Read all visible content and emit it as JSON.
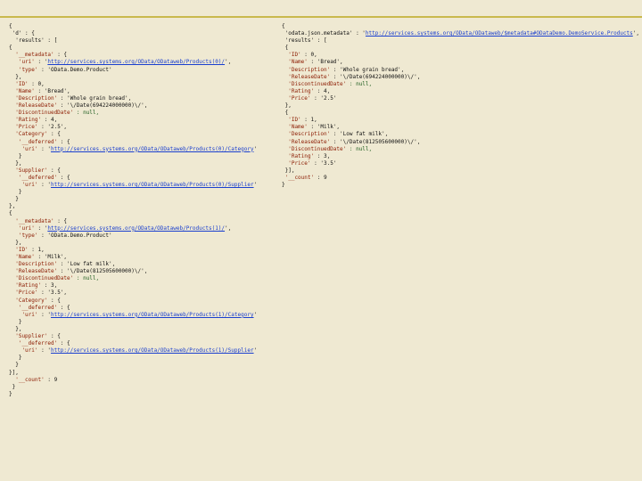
{
  "left": {
    "l01": "{",
    "l02": " 'd' : {",
    "l03": "  'results' : [",
    "l04": "{",
    "l05_k": "  '__metadata'",
    "l05_s": " : {",
    "l06_k": "   'uri'",
    "l06_s": " : '",
    "l06_u": "http://services.systems.org/OData/ODataweb/Products(0)/",
    "l06_e": "',",
    "l07_k": "   'type'",
    "l07_v": " : 'OData.Demo.Product'",
    "l08": "  },",
    "l09_k": "  'ID'",
    "l09_v": " : 0,",
    "l10_k": "  'Name'",
    "l10_v": " : 'Bread',",
    "l11_k": "  'Description'",
    "l11_v": " : 'Whole grain bread',",
    "l12_k": "  'ReleaseDate'",
    "l12_v": " : '\\/Date(694224000000)\\/',",
    "l13_k": "  'DiscontinuedDate'",
    "l13_v": " : null,",
    "l14_k": "  'Rating'",
    "l14_v": " : 4,",
    "l15_k": "  'Price'",
    "l15_v": " : '2.5',",
    "l16_k": "  'Category'",
    "l16_s": " : {",
    "l17_k": "   '__deferred'",
    "l17_s": " : {",
    "l18_k": "    'uri'",
    "l18_s": " : '",
    "l18_u": "http://services.systems.org/OData/ODataweb/Products(0)/Category",
    "l18_e": "'",
    "l19": "   }",
    "l20": "  },",
    "l21_k": "  'Supplier'",
    "l21_s": " : {",
    "l22_k": "   '__deferred'",
    "l22_s": " : {",
    "l23_k": "    'uri'",
    "l23_s": " : '",
    "l23_u": "http://services.systems.org/OData/ODataweb/Products(0)/Supplier",
    "l23_e": "'",
    "l24": "   }",
    "l25": "  }",
    "l26": "},",
    "l27": "{",
    "l28_k": "  '__metadata'",
    "l28_s": " : {",
    "l29_k": "   'uri'",
    "l29_s": " : '",
    "l29_u": "http://services.systems.org/OData/ODataweb/Products(1)/",
    "l29_e": "',",
    "l30_k": "   'type'",
    "l30_v": " : 'OData.Demo.Product'",
    "l31": "  },",
    "l32_k": "  'ID'",
    "l32_v": " : 1,",
    "l33_k": "  'Name'",
    "l33_v": " : 'Milk',",
    "l34_k": "  'Description'",
    "l34_v": " : 'Low fat milk',",
    "l35_k": "  'ReleaseDate'",
    "l35_v": " : '\\/Date(812505600000)\\/',",
    "l36_k": "  'DiscontinuedDate'",
    "l36_v": " : null,",
    "l37_k": "  'Rating'",
    "l37_v": " : 3,",
    "l38_k": "  'Price'",
    "l38_v": " : '3.5',",
    "l39_k": "  'Category'",
    "l39_s": " : {",
    "l40_k": "   '__deferred'",
    "l40_s": " : {",
    "l41_k": "    'uri'",
    "l41_s": " : '",
    "l41_u": "http://services.systems.org/OData/ODataweb/Products(1)/Category",
    "l41_e": "'",
    "l42": "   }",
    "l43": "  },",
    "l44_k": "  'Supplier'",
    "l44_s": " : {",
    "l45_k": "   '__deferred'",
    "l45_s": " : {",
    "l46_k": "    'uri'",
    "l46_s": " : '",
    "l46_u": "http://services.systems.org/OData/ODataweb/Products(1)/Supplier",
    "l46_e": "'",
    "l47": "   }",
    "l48": "  }",
    "l49": "}],",
    "l50_k": "  '__count'",
    "l50_v": " : 9",
    "l51": " }",
    "l52": "}"
  },
  "right": {
    "r01": "{",
    "r02_p": " 'odata.json.metadata' : '",
    "r02_u": "http://services.systems.org/OData/ODataweb/$metadata#ODataDemo.DemoService.Products",
    "r02_e": "',",
    "r03": " 'results' : [",
    "r04": " {",
    "r05_k": "  'ID'",
    "r05_v": " : 0,",
    "r06_k": "  'Name'",
    "r06_v": " : 'Bread',",
    "r07_k": "  'Description'",
    "r07_v": " : 'Whole grain bread',",
    "r08_k": "  'ReleaseDate'",
    "r08_v": " : '\\/Date(694224000000)\\/',",
    "r09_k": "  'DiscontinuedDate'",
    "r09_v": " : null,",
    "r10_k": "  'Rating'",
    "r10_v": " : 4,",
    "r11_k": "  'Price'",
    "r11_v": " : '2.5'",
    "r12": " },",
    "r13": " {",
    "r14_k": "  'ID'",
    "r14_v": " : 1,",
    "r15_k": "  'Name'",
    "r15_v": " : 'Milk',",
    "r16_k": "  'Description'",
    "r16_v": " : 'Low fat milk',",
    "r17_k": "  'ReleaseDate'",
    "r17_v": " : '\\/Date(812505600000)\\/',",
    "r18_k": "  'DiscontinuedDate'",
    "r18_v": " : null,",
    "r19_k": "  'Rating'",
    "r19_v": " : 3,",
    "r20_k": "  'Price'",
    "r20_v": " : '3.5'",
    "r21": " }],",
    "r22_k": " '__count'",
    "r22_v": " : 9",
    "r23": "}"
  }
}
